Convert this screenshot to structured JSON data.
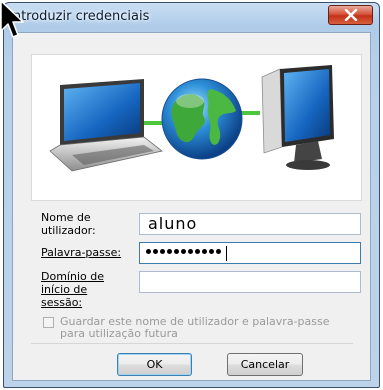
{
  "window": {
    "title": "Introduzir credenciais",
    "close_icon": "close-icon"
  },
  "banner": {
    "image_description_icons": [
      "laptop-icon",
      "globe-icon",
      "desktop-monitor-icon"
    ]
  },
  "form": {
    "username_label": "Nome de utilizador:",
    "username_value": "aluno",
    "password_label": "Palavra-passe:",
    "password_length": 11,
    "domain_label": "Domínio de início de sessão:",
    "domain_value": ""
  },
  "save_option": {
    "label": "Guardar este nome de utilizador e palavra-passe para utilização futura",
    "checked": false,
    "enabled": false
  },
  "buttons": {
    "ok_label": "OK",
    "cancel_label": "Cancelar"
  },
  "colors": {
    "title_bar": "#aecbe8",
    "close_button": "#c43019",
    "client_bg": "#f0f0f0",
    "focus_border": "#3d7bad"
  }
}
